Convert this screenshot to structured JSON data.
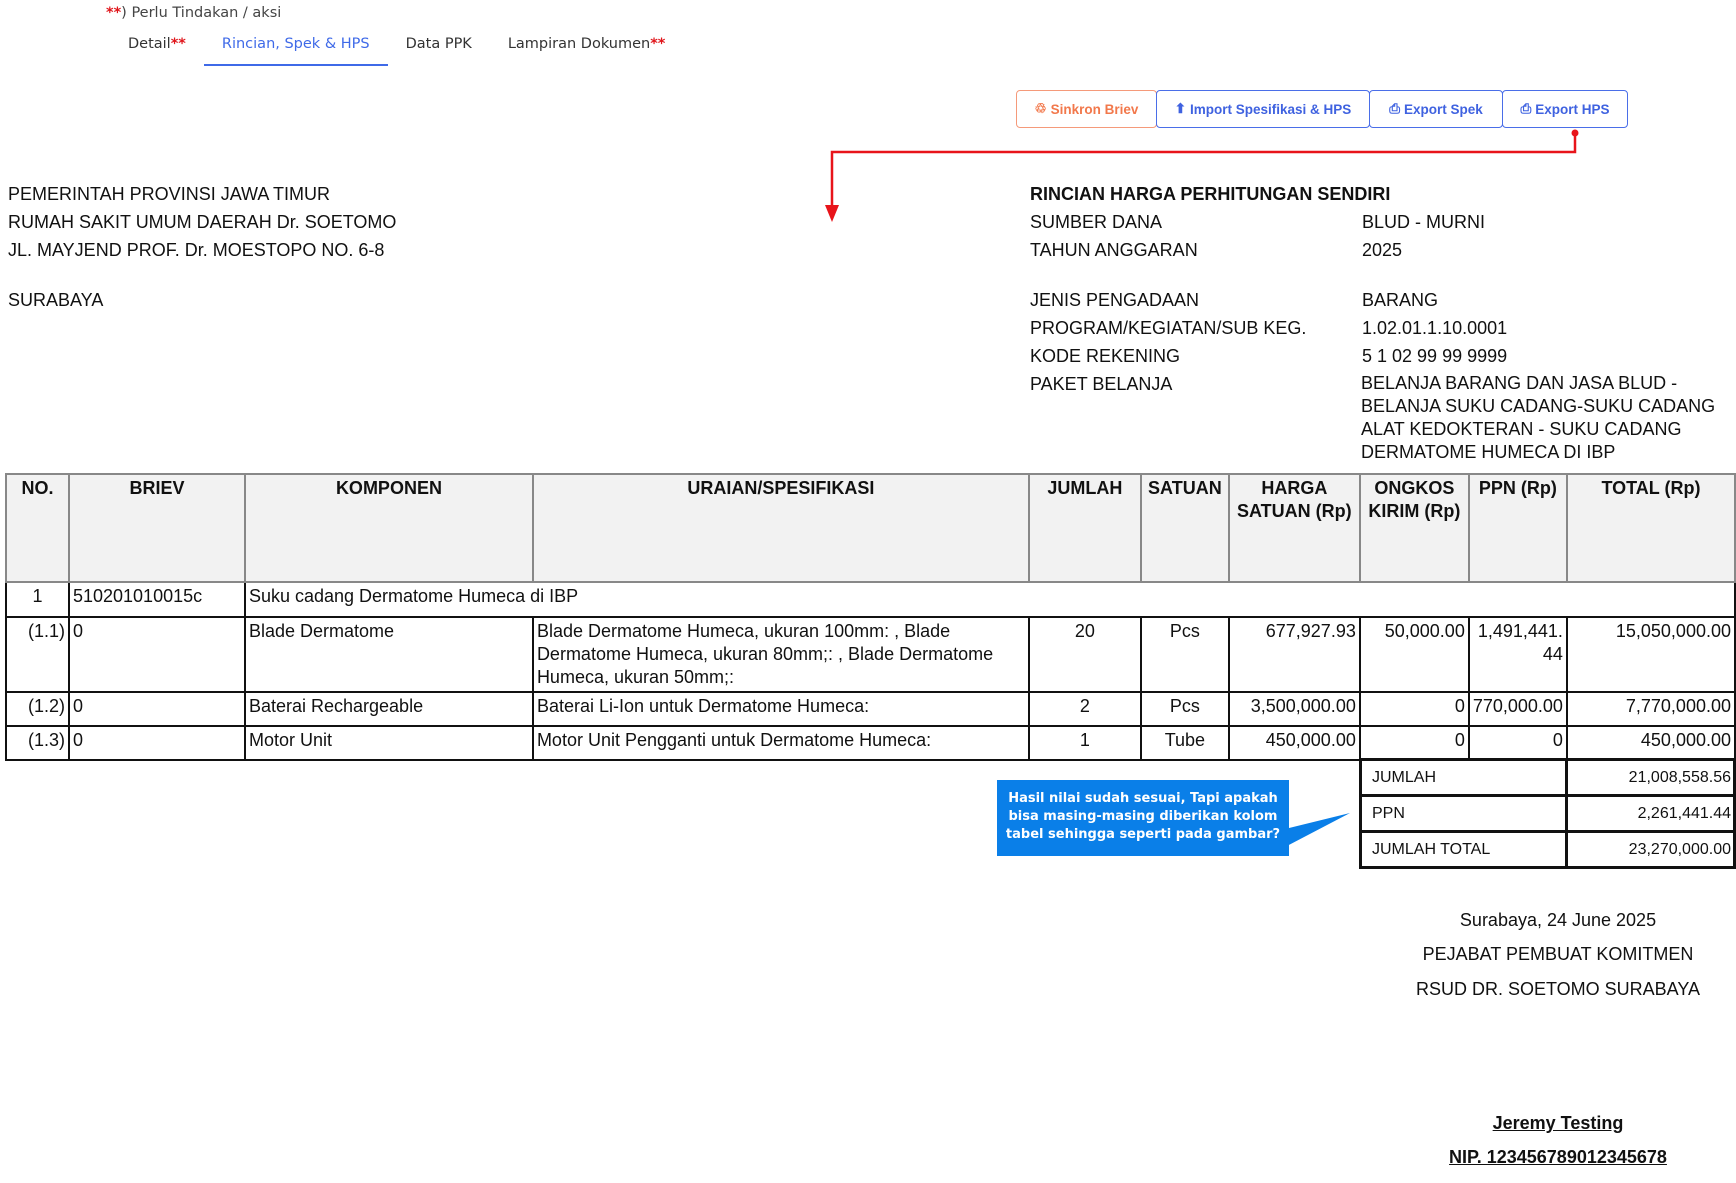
{
  "notice": {
    "marker": "**",
    "text": ") Perlu Tindakan / aksi"
  },
  "tabs": [
    {
      "label": "Detail",
      "marker": "**"
    },
    {
      "label": "Rincian, Spek & HPS",
      "marker": ""
    },
    {
      "label": "Data PPK",
      "marker": ""
    },
    {
      "label": "Lampiran Dokumen",
      "marker": "**"
    }
  ],
  "toolbar": {
    "sinkron": "Sinkron Briev",
    "import": "Import Spesifikasi & HPS",
    "export_spek": "Export Spek",
    "export_hps": "Export HPS"
  },
  "header_left": [
    "PEMERINTAH PROVINSI JAWA TIMUR",
    "RUMAH SAKIT UMUM DAERAH Dr. SOETOMO",
    "JL. MAYJEND PROF. Dr. MOESTOPO NO. 6-8",
    "SURABAYA"
  ],
  "header_right": {
    "title": "RINCIAN HARGA PERHITUNGAN SENDIRI",
    "rows": [
      {
        "label": "SUMBER DANA",
        "value": "BLUD - MURNI"
      },
      {
        "label": "TAHUN ANGGARAN",
        "value": "2025"
      },
      {
        "label": "JENIS PENGADAAN",
        "value": "BARANG"
      },
      {
        "label": "PROGRAM/KEGIATAN/SUB KEG.",
        "value": "1.02.01.1.10.0001"
      },
      {
        "label": "KODE REKENING",
        "value": "5 1 02 99 99 9999"
      },
      {
        "label": "PAKET BELANJA",
        "value": "BELANJA BARANG DAN JASA BLUD - BELANJA SUKU CADANG-SUKU CADANG ALAT KEDOKTERAN - SUKU CADANG DERMATOME HUMECA DI IBP"
      }
    ]
  },
  "table": {
    "headers": [
      "NO.",
      "BRIEV",
      "KOMPONEN",
      "URAIAN/SPESIFIKASI",
      "JUMLAH",
      "SATUAN",
      "HARGA SATUAN (Rp)",
      "ONGKOS KIRIM (Rp)",
      "PPN (Rp)",
      "TOTAL (Rp)"
    ],
    "group": {
      "no": "1",
      "briev": "510201010015c",
      "komponen": "Suku cadang Dermatome Humeca di IBP"
    },
    "rows": [
      {
        "no": "(1.1)",
        "briev": "0",
        "komponen": "Blade Dermatome",
        "uraian": "Blade Dermatome Humeca, ukuran 100mm: , Blade Dermatome Humeca, ukuran 80mm;: , Blade Dermatome Humeca, ukuran 50mm;:",
        "jumlah": "20",
        "satuan": "Pcs",
        "harga": "677,927.93",
        "ongkir": "50,000.00",
        "ppn": "1,491,441.44",
        "total": "15,050,000.00"
      },
      {
        "no": "(1.2)",
        "briev": "0",
        "komponen": "Baterai Rechargeable",
        "uraian": "Baterai Li-Ion untuk Dermatome Humeca:",
        "jumlah": "2",
        "satuan": "Pcs",
        "harga": "3,500,000.00",
        "ongkir": "0",
        "ppn": "770,000.00",
        "total": "7,770,000.00"
      },
      {
        "no": "(1.3)",
        "briev": "0",
        "komponen": "Motor Unit",
        "uraian": "Motor Unit Pengganti untuk Dermatome Humeca:",
        "jumlah": "1",
        "satuan": "Tube",
        "harga": "450,000.00",
        "ongkir": "0",
        "ppn": "0",
        "total": "450,000.00"
      }
    ]
  },
  "summary": [
    {
      "label": "JUMLAH",
      "value": "21,008,558.56"
    },
    {
      "label": "PPN",
      "value": "2,261,441.44"
    },
    {
      "label": "JUMLAH TOTAL",
      "value": "23,270,000.00"
    }
  ],
  "callout": "Hasil nilai sudah sesuai, Tapi apakah bisa masing-masing diberikan kolom tabel sehingga seperti pada gambar?",
  "footer": {
    "place_date": "Surabaya, 24 June 2025",
    "role": "PEJABAT PEMBUAT KOMITMEN",
    "org": "RSUD DR. SOETOMO SURABAYA",
    "name": "Jeremy Testing",
    "nip": "NIP. 123456789012345678"
  },
  "colors": {
    "accent": "#3f6ae8",
    "required": "#e0161b",
    "annotation_red": "#e8141a",
    "callout": "#0a7fe8",
    "orange": "#f2784b"
  }
}
